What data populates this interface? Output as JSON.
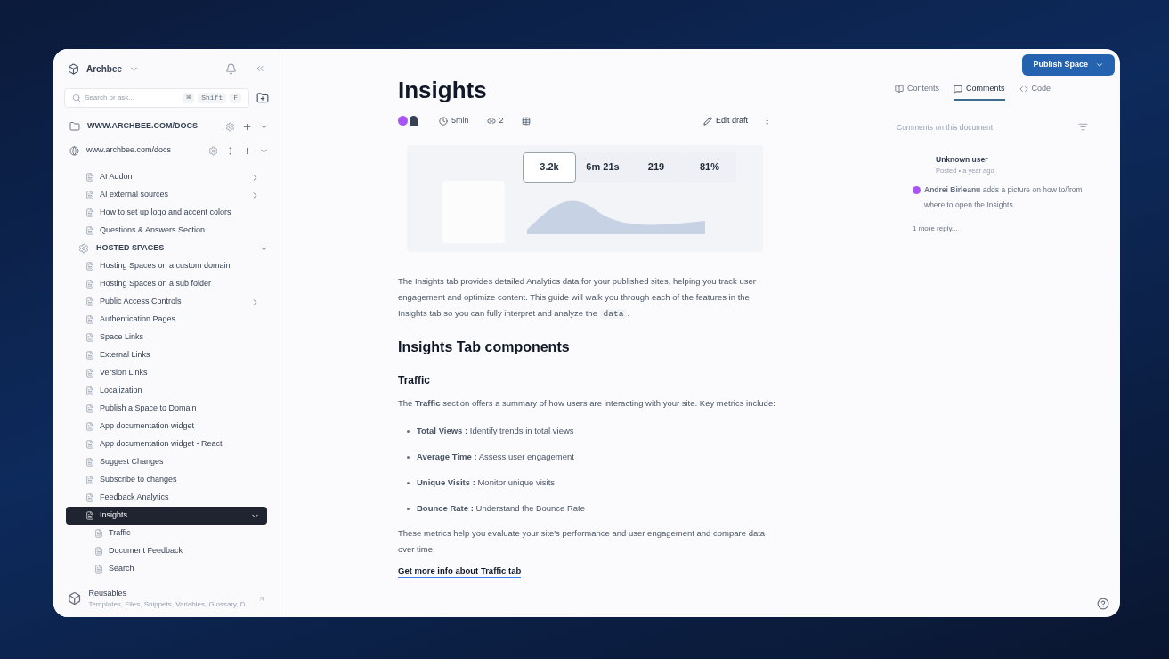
{
  "sidebar": {
    "workspace": "Archbee",
    "search": {
      "placeholder": "Search or ask...",
      "keys": [
        "⌘",
        "Shift",
        "F"
      ]
    },
    "section": "WWW.ARCHBEE.COM/DOCS",
    "space": "www.archbee.com/docs",
    "items": [
      {
        "kind": "page",
        "label": "AI Addon",
        "selected": false,
        "expanded": false
      },
      {
        "kind": "page",
        "label": "AI external sources",
        "selected": false,
        "expanded": false
      },
      {
        "kind": "page",
        "label": "How to set up logo and accent colors",
        "selected": false
      },
      {
        "kind": "page",
        "label": "Questions & Answers Section",
        "selected": false
      },
      {
        "kind": "group",
        "label": "HOSTED SPACES",
        "expanded": true,
        "children": [
          {
            "kind": "page",
            "label": "Hosting Spaces on a custom domain",
            "selected": false
          },
          {
            "kind": "page",
            "label": "Hosting Spaces on a sub folder",
            "selected": false
          },
          {
            "kind": "page",
            "label": "Public Access Controls",
            "selected": false,
            "expanded": false
          },
          {
            "kind": "page",
            "label": "Authentication Pages",
            "selected": false
          },
          {
            "kind": "page",
            "label": "Space Links",
            "selected": false
          },
          {
            "kind": "page",
            "label": "External Links",
            "selected": false
          },
          {
            "kind": "page",
            "label": "Version Links",
            "selected": false
          },
          {
            "kind": "page",
            "label": "Localization",
            "selected": false
          },
          {
            "kind": "page",
            "label": "Publish a Space to Domain",
            "selected": false
          },
          {
            "kind": "page",
            "label": "App documentation widget",
            "selected": false
          },
          {
            "kind": "page",
            "label": "App documentation widget - React",
            "selected": false
          },
          {
            "kind": "page",
            "label": "Suggest Changes",
            "selected": false
          },
          {
            "kind": "page",
            "label": "Subscribe to changes",
            "selected": false
          },
          {
            "kind": "page",
            "label": "Feedback Analytics",
            "selected": false
          },
          {
            "kind": "page",
            "label": "Insights",
            "selected": true,
            "expanded": true,
            "children": [
              {
                "kind": "page",
                "label": "Traffic",
                "selected": false
              },
              {
                "kind": "page",
                "label": "Document Feedback",
                "selected": false
              },
              {
                "kind": "page",
                "label": "Search",
                "selected": false
              }
            ]
          }
        ]
      }
    ],
    "footer": {
      "title": "Reusables",
      "subtitle": "Templates, Files, Snippets, Variables, Glossary, D..."
    }
  },
  "document": {
    "title": "Insights",
    "read_time": "5min",
    "links": "2",
    "edit": "Edit draft",
    "hero_stats": [
      {
        "value": "3.2k",
        "selected": true
      },
      {
        "value": "6m 21s",
        "selected": false
      },
      {
        "value": "219",
        "selected": false
      },
      {
        "value": "81%",
        "selected": false
      }
    ],
    "intro": "The Insights tab provides detailed Analytics data for your published sites, helping you track user engagement and optimize content. This guide will walk you through each of the features in the Insights tab so you can fully interpret and analyze the",
    "intro_code": "data",
    "intro_end": ".",
    "heading": "Insights Tab components",
    "subheading": "Traffic",
    "traffic_text": "The **Traffic** section offers a summary of how users are interacting with your site. Key metrics include:",
    "bullets": [
      "**Total Views :** Identify trends in total views",
      "**Average Time :** Assess user engagement",
      "**Unique Visits :** Monitor unique visits",
      "**Bounce Rate :** Understand the Bounce Rate"
    ],
    "closing": "These metrics help you evaluate your site's performance and user engagement and compare data over time.",
    "link": "Get more info about Traffic tab"
  },
  "right_panel": {
    "publish": "Publish Space",
    "tabs": [
      {
        "label": "Contents",
        "selected": false
      },
      {
        "label": "Comments",
        "selected": true
      },
      {
        "label": "Code",
        "selected": false
      }
    ],
    "comments_header": "Comments on this document",
    "comment": {
      "author": "Unknown user",
      "time": "Posted • a year ago",
      "body": "**Andrei Birleanu** adds a picture on how to/from where to open the Insights",
      "more": "1 more reply..."
    }
  }
}
